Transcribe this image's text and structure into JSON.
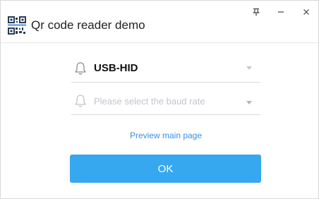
{
  "window": {
    "title": "Qr code reader demo",
    "app_icon": "qr-code-icon",
    "controls": {
      "pin_icon": "pin-icon",
      "minimize_icon": "minimize-icon",
      "close_icon": "close-icon"
    }
  },
  "form": {
    "interface_select": {
      "value": "USB-HID",
      "icon": "bell-icon"
    },
    "baud_rate_select": {
      "placeholder": "Please select the baud rate",
      "icon": "bell-icon"
    },
    "preview_link": "Preview main page",
    "ok_button": "OK"
  },
  "colors": {
    "primary": "#35a8f0",
    "link": "#3a8ee6",
    "placeholder": "#c0c4cc"
  }
}
